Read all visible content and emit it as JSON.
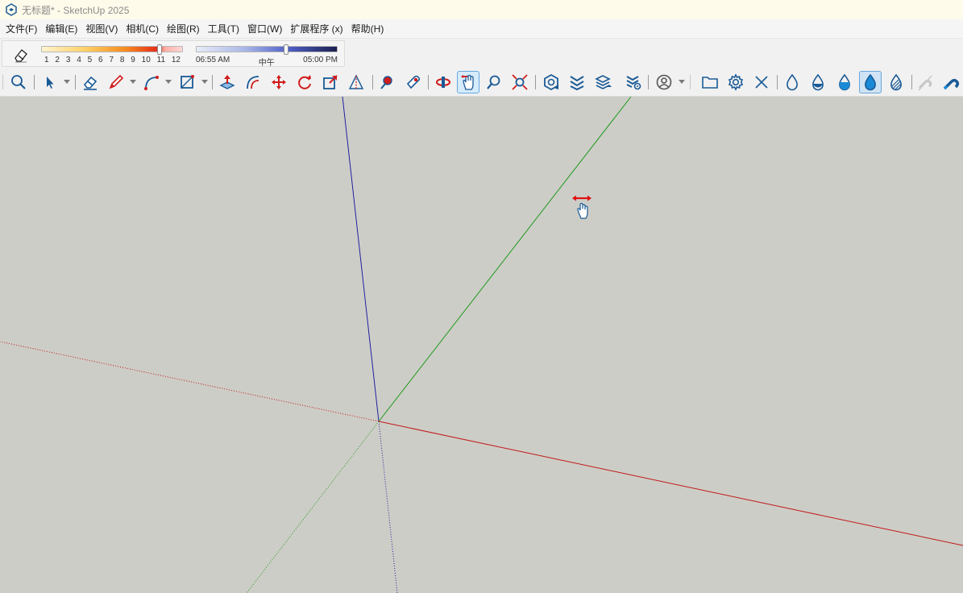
{
  "window": {
    "title": "无标题* - SketchUp 2025",
    "app_icon": "sketchup-logo-icon"
  },
  "menu": [
    {
      "label": "文件(F)"
    },
    {
      "label": "编辑(E)"
    },
    {
      "label": "视图(V)"
    },
    {
      "label": "相机(C)"
    },
    {
      "label": "绘图(R)"
    },
    {
      "label": "工具(T)"
    },
    {
      "label": "窗口(W)"
    },
    {
      "label": "扩展程序 (x)"
    },
    {
      "label": "帮助(H)"
    }
  ],
  "shadows": {
    "month_ticks": [
      "1",
      "2",
      "3",
      "4",
      "5",
      "6",
      "7",
      "8",
      "9",
      "10",
      "11",
      "12"
    ],
    "month_value": 0.83,
    "time_ticks": [
      "06:55 AM",
      "中午",
      "05:00 PM"
    ],
    "time_value": 0.63
  },
  "toolbar": {
    "tools": [
      {
        "name": "zoom-extents-icon"
      },
      {
        "name": "select-icon"
      },
      {
        "name": "eraser-icon"
      },
      {
        "name": "pencil-line-icon"
      },
      {
        "name": "arc-icon"
      },
      {
        "name": "rectangle-icon"
      },
      {
        "name": "push-pull-icon"
      },
      {
        "name": "offset-icon"
      },
      {
        "name": "move-icon"
      },
      {
        "name": "rotate-icon"
      },
      {
        "name": "scale-icon"
      },
      {
        "name": "tape-measure-icon"
      },
      {
        "name": "paint-bucket-icon"
      },
      {
        "name": "sample-paint-icon"
      },
      {
        "name": "orbit-icon"
      },
      {
        "name": "pan-icon",
        "active": true
      },
      {
        "name": "zoom-icon"
      },
      {
        "name": "zoom-window-icon"
      },
      {
        "name": "3d-warehouse-icon"
      },
      {
        "name": "extension-warehouse-icon"
      },
      {
        "name": "layout-send-icon"
      },
      {
        "name": "extension-manager-icon"
      },
      {
        "name": "account-icon"
      },
      {
        "name": "open-folder-icon"
      },
      {
        "name": "settings-gear-icon"
      },
      {
        "name": "close-x-icon"
      },
      {
        "name": "style-xray-icon"
      },
      {
        "name": "style-wireframe-icon"
      },
      {
        "name": "style-shaded-icon"
      },
      {
        "name": "style-shaded-textures-icon",
        "active": true
      },
      {
        "name": "style-monochrome-icon"
      },
      {
        "name": "magnet-disabled-icon"
      },
      {
        "name": "magnet-icon"
      }
    ]
  },
  "colors": {
    "viewport_bg": "#cdcdc7",
    "red_axis": "#c01818",
    "green_axis": "#1e9a1e",
    "blue_axis": "#2020a0",
    "icon_blue": "#1a5a96"
  }
}
